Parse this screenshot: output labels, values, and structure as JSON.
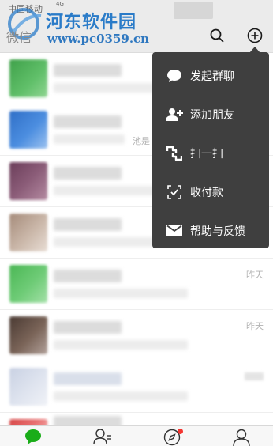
{
  "status_bar": {
    "carrier": "中国移动",
    "signal_mini": "4G"
  },
  "watermark": {
    "title": "河东软件园",
    "url": "www.pc0359.cn"
  },
  "header": {
    "title": "微信"
  },
  "menu": {
    "items": [
      {
        "label": "发起群聊",
        "icon": "chat-bubble-icon"
      },
      {
        "label": "添加朋友",
        "icon": "add-friend-icon"
      },
      {
        "label": "扫一扫",
        "icon": "scan-icon"
      },
      {
        "label": "收付款",
        "icon": "payment-scan-icon"
      },
      {
        "label": "帮助与反馈",
        "icon": "mail-icon"
      }
    ]
  },
  "chats": [
    {
      "time": "",
      "snippet": ""
    },
    {
      "time": "",
      "snippet": "池是"
    },
    {
      "time": "",
      "snippet": ""
    },
    {
      "time": "",
      "snippet": ""
    },
    {
      "time": "昨天",
      "snippet": ""
    },
    {
      "time": "昨天",
      "snippet": ""
    },
    {
      "time": "",
      "snippet": ""
    },
    {
      "time": "",
      "snippet": ""
    }
  ],
  "tabbar": {
    "tabs": [
      {
        "name": "chats",
        "icon": "chat-icon",
        "active": true
      },
      {
        "name": "contacts",
        "icon": "contacts-icon",
        "active": false
      },
      {
        "name": "discover",
        "icon": "compass-icon",
        "active": false,
        "badge_dot": true
      },
      {
        "name": "me",
        "icon": "person-icon",
        "active": false
      }
    ]
  },
  "colors": {
    "accent": "#1aad19",
    "menu_bg": "#3f3f3f",
    "badge": "#f43530",
    "header_bg": "#ebebeb",
    "watermark": "#2a7bc8"
  }
}
